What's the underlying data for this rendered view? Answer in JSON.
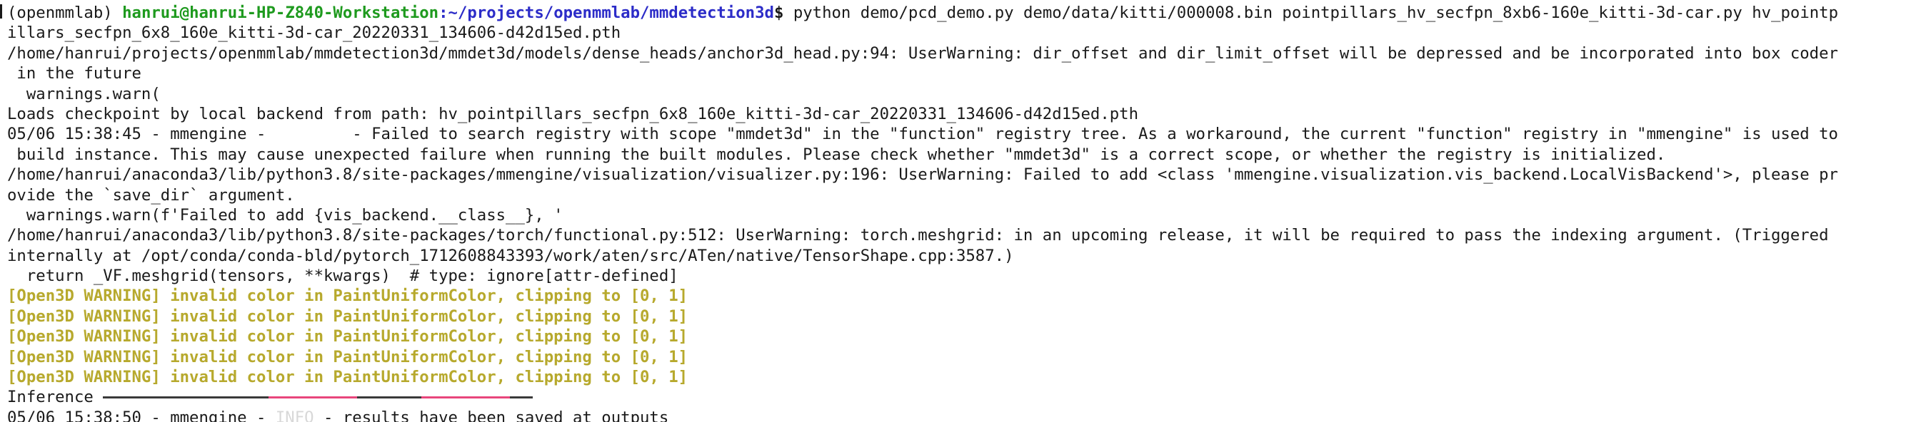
{
  "prompt": {
    "env": "(openmmlab)",
    "user_host": "hanrui@hanrui-HP-Z840-Workstation",
    "path": ":~/projects/openmmlab/mmdetection3d",
    "dollar": "$",
    "command": " python demo/pcd_demo.py demo/data/kitti/000008.bin pointpillars_hv_secfpn_8xb6-160e_kitti-3d-car.py hv_pointp"
  },
  "output_lines": [
    "illars_secfpn_6x8_160e_kitti-3d-car_20220331_134606-d42d15ed.pth",
    "/home/hanrui/projects/openmmlab/mmdetection3d/mmdet3d/models/dense_heads/anchor3d_head.py:94: UserWarning: dir_offset and dir_limit_offset will be depressed and be incorporated into box coder",
    " in the future",
    "  warnings.warn(",
    "Loads checkpoint by local backend from path: hv_pointpillars_secfpn_6x8_160e_kitti-3d-car_20220331_134606-d42d15ed.pth",
    "05/06 15:38:45 - mmengine -         - Failed to search registry with scope \"mmdet3d\" in the \"function\" registry tree. As a workaround, the current \"function\" registry in \"mmengine\" is used to",
    " build instance. This may cause unexpected failure when running the built modules. Please check whether \"mmdet3d\" is a correct scope, or whether the registry is initialized.",
    "/home/hanrui/anaconda3/lib/python3.8/site-packages/mmengine/visualization/visualizer.py:196: UserWarning: Failed to add <class 'mmengine.visualization.vis_backend.LocalVisBackend'>, please pr",
    "ovide the `save_dir` argument.",
    "  warnings.warn(f'Failed to add {vis_backend.__class__}, '",
    "/home/hanrui/anaconda3/lib/python3.8/site-packages/torch/functional.py:512: UserWarning: torch.meshgrid: in an upcoming release, it will be required to pass the indexing argument. (Triggered",
    "internally at /opt/conda/conda-bld/pytorch_1712608843393/work/aten/src/ATen/native/TensorShape.cpp:3587.)",
    "  return _VF.meshgrid(tensors, **kwargs)  # type: ignore[attr-defined]"
  ],
  "warning_lines": [
    "[Open3D WARNING] invalid color in PaintUniformColor, clipping to [0, 1]",
    "[Open3D WARNING] invalid color in PaintUniformColor, clipping to [0, 1]",
    "[Open3D WARNING] invalid color in PaintUniformColor, clipping to [0, 1]",
    "[Open3D WARNING] invalid color in PaintUniformColor, clipping to [0, 1]",
    "[Open3D WARNING] invalid color in PaintUniformColor, clipping to [0, 1]"
  ],
  "inference": {
    "label": "Inference "
  },
  "final_line": {
    "prefix": "05/06 15:38:50 - mmengine - ",
    "level": "INFO",
    "message": " - results have been saved at outputs"
  },
  "colors": {
    "prompt_user": "#1e9a1e",
    "prompt_path": "#2c2cc8",
    "warning": "#b7a92d",
    "progress_highlight": "#e8467c",
    "progress_track": "#3a3a3a",
    "text": "#1a1a1a"
  }
}
